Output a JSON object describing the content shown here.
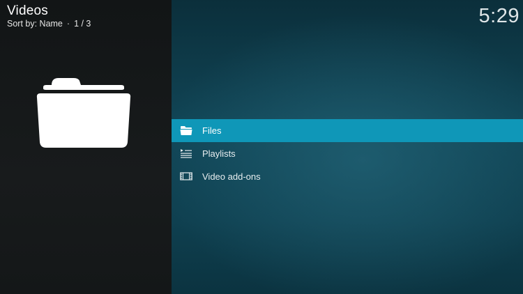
{
  "header": {
    "title": "Videos",
    "sort_label": "Sort by: Name",
    "separator": "·",
    "position": "1 / 3"
  },
  "clock": "5:29",
  "preview": {
    "icon": "folder-icon"
  },
  "menu": {
    "items": [
      {
        "label": "Files",
        "icon": "folder-icon",
        "selected": true
      },
      {
        "label": "Playlists",
        "icon": "playlist-icon",
        "selected": false
      },
      {
        "label": "Video add-ons",
        "icon": "film-icon",
        "selected": false
      }
    ]
  },
  "colors": {
    "selection": "#0f97b8",
    "left_panel": "#161a1b",
    "background": "#0f3a48"
  }
}
